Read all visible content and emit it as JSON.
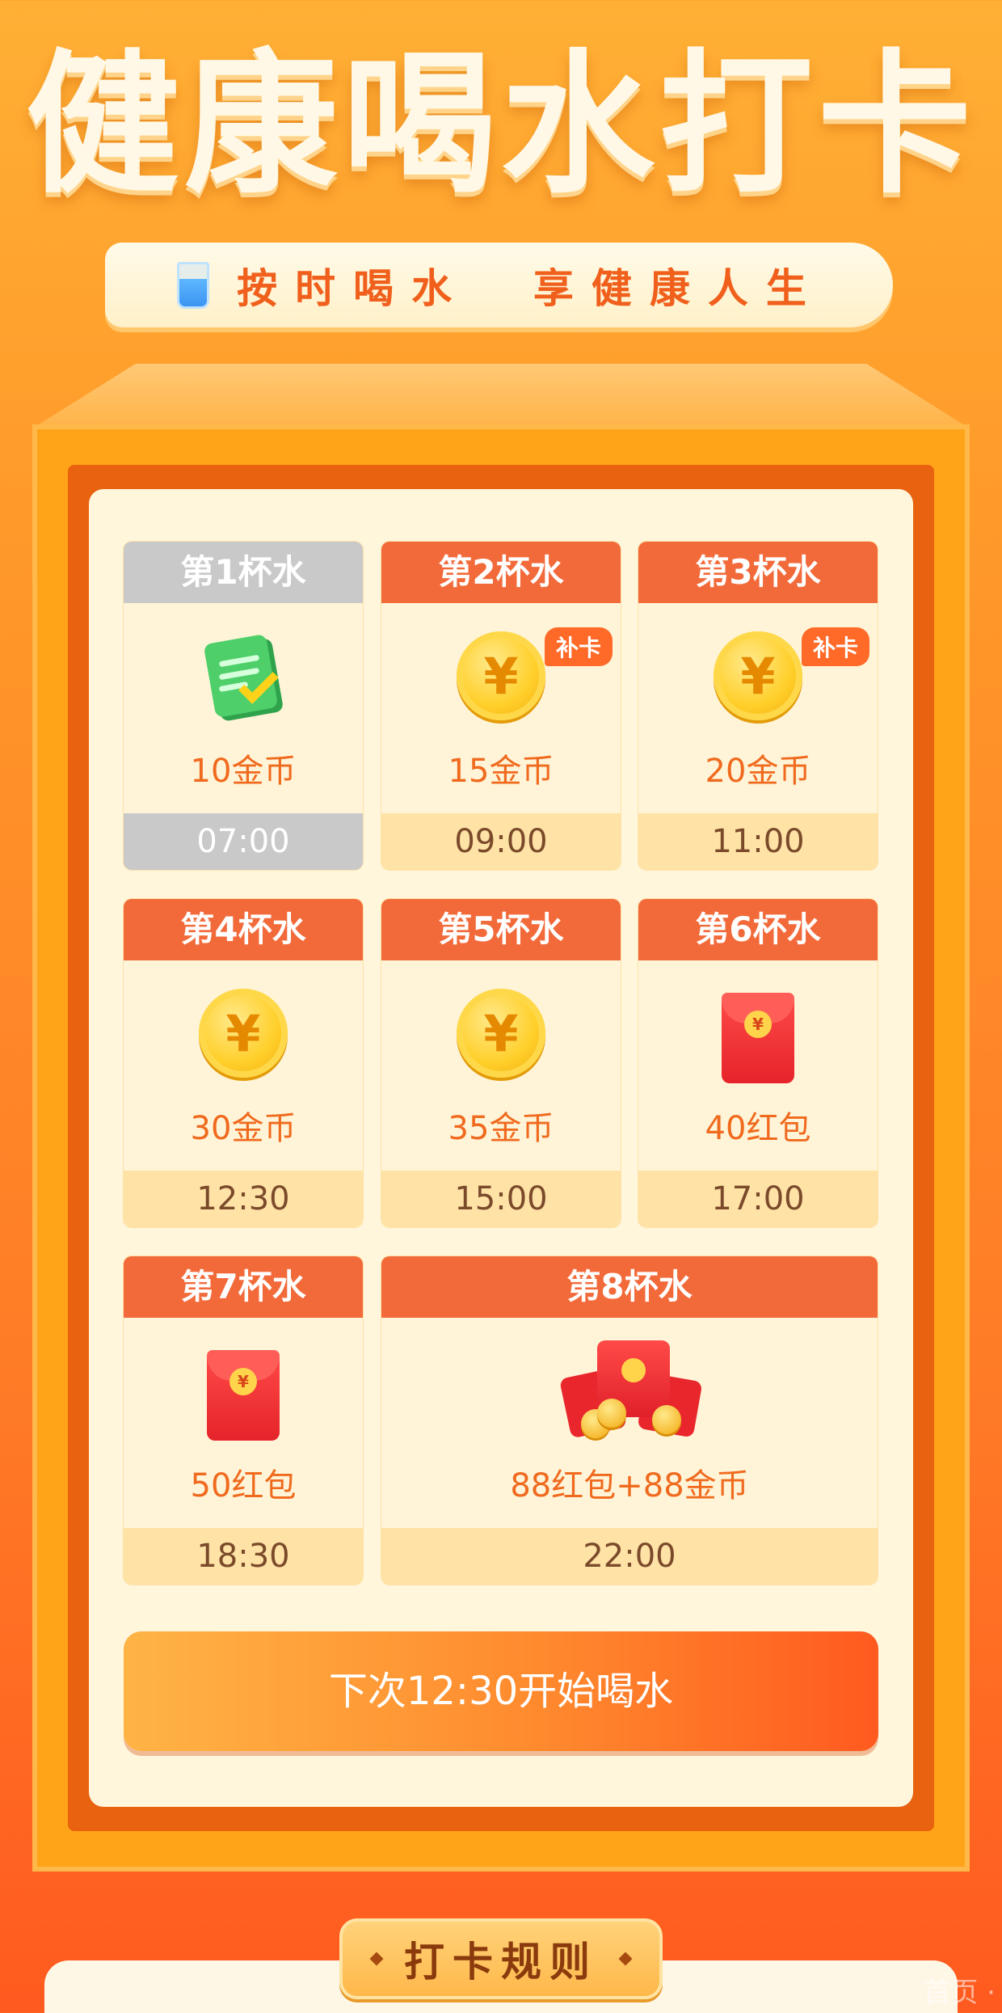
{
  "header": {
    "title": "健康喝水打卡",
    "subtitle": "按时喝水  享健康人生"
  },
  "cards": [
    {
      "title": "第1杯水",
      "reward": "10金币",
      "time": "07:00",
      "icon": "notepad-check-icon",
      "state": "done"
    },
    {
      "title": "第2杯水",
      "reward": "15金币",
      "time": "09:00",
      "icon": "coin-icon",
      "badge": "补卡"
    },
    {
      "title": "第3杯水",
      "reward": "20金币",
      "time": "11:00",
      "icon": "coin-icon",
      "badge": "补卡"
    },
    {
      "title": "第4杯水",
      "reward": "30金币",
      "time": "12:30",
      "icon": "coin-icon"
    },
    {
      "title": "第5杯水",
      "reward": "35金币",
      "time": "15:00",
      "icon": "coin-icon"
    },
    {
      "title": "第6杯水",
      "reward": "40红包",
      "time": "17:00",
      "icon": "red-envelope-icon"
    },
    {
      "title": "第7杯水",
      "reward": "50红包",
      "time": "18:30",
      "icon": "red-envelope-icon"
    },
    {
      "title": "第8杯水",
      "reward": "88红包+88金币",
      "time": "22:00",
      "icon": "red-envelope-bundle-icon"
    }
  ],
  "coin_symbol": "¥",
  "action": {
    "label": "下次12:30开始喝水"
  },
  "rules": {
    "title": "打卡规则"
  },
  "watermark": "首页 ·"
}
